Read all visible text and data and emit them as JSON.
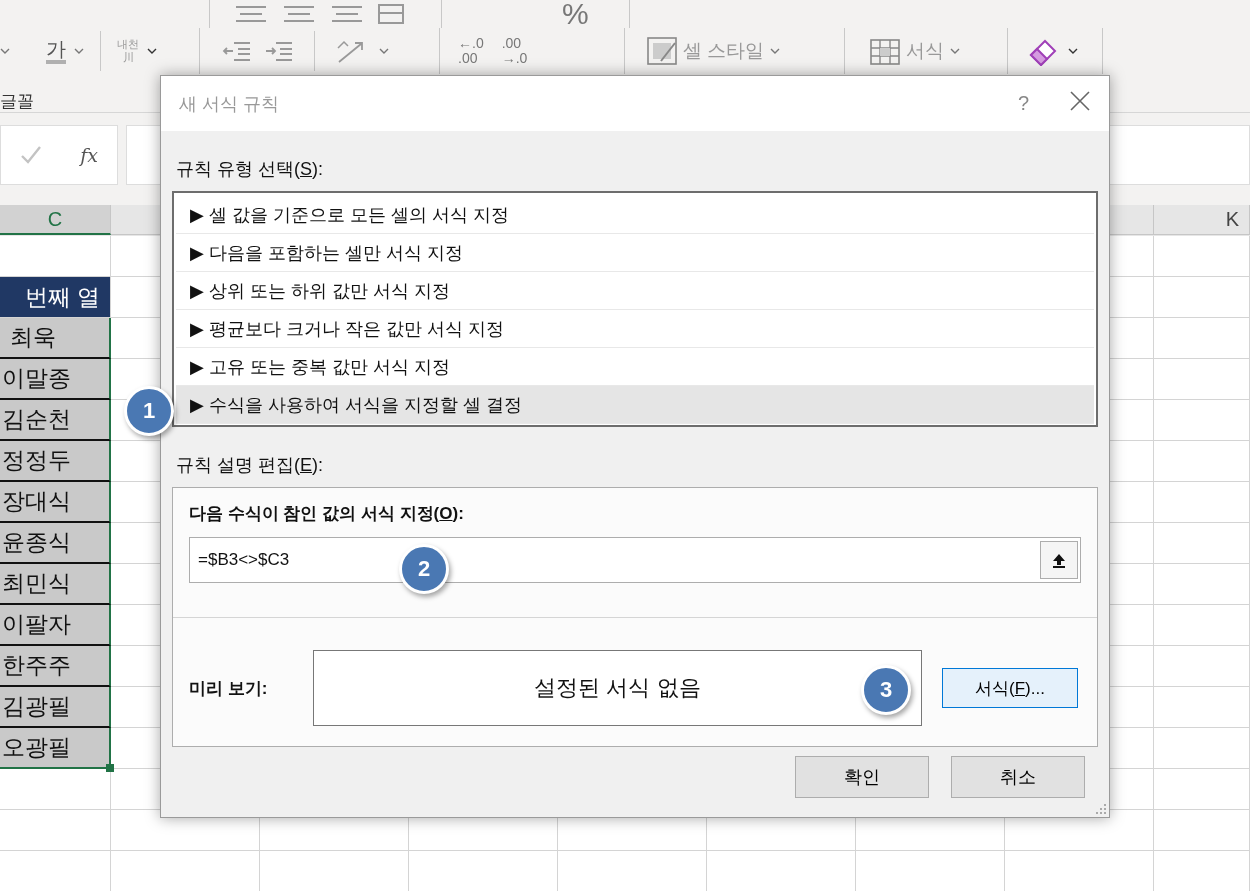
{
  "ribbon": {
    "font_color": "가",
    "phonetic": [
      "내천",
      "川"
    ],
    "percent": "%",
    "decimals": [
      {
        "top": "←.0",
        "bottom": ".00"
      },
      {
        "top": ".00",
        "bottom": "→.0"
      }
    ],
    "cell_styles": "셀 스타일",
    "format": "서식",
    "group_label": "글꼴"
  },
  "formula_bar": {
    "function_label": "fx"
  },
  "sheet": {
    "columns": [
      {
        "label": "C"
      },
      {
        "label": "K"
      }
    ],
    "column_header": "번째 열",
    "names": [
      "최욱",
      "이말종",
      "김순천",
      "정정두",
      "장대식",
      "윤종식",
      "최민식",
      "이팔자",
      "한주주",
      "김광필",
      "오광필"
    ]
  },
  "dialog": {
    "title": "새 서식 규칙",
    "help": "?",
    "rule_type_label": {
      "before": "규칙 유형 선택(",
      "key": "S",
      "after": "):"
    },
    "rule_types": [
      {
        "label": "▶ 셀 값을 기준으로 모든 셀의 서식 지정",
        "selected": false
      },
      {
        "label": "▶ 다음을 포함하는 셀만 서식 지정",
        "selected": false
      },
      {
        "label": "▶ 상위 또는 하위 값만 서식 지정",
        "selected": false
      },
      {
        "label": "▶ 평균보다 크거나 작은 값만 서식 지정",
        "selected": false
      },
      {
        "label": "▶ 고유 또는 중복 값만 서식 지정",
        "selected": false
      },
      {
        "label": "▶ 수식을 사용하여 서식을 지정할 셀 결정",
        "selected": true
      }
    ],
    "edit_label": {
      "before": "규칙 설명 편집(",
      "key": "E",
      "after": "):"
    },
    "formula_label": {
      "before": "다음 수식이 참인 값의 서식 지정(",
      "key": "O",
      "after": "):"
    },
    "formula": "=$B3<>$C3",
    "preview_label": "미리 보기:",
    "preview_text": "설정된 서식 없음",
    "format_button": {
      "before": "서식(",
      "key": "F",
      "after": ")..."
    },
    "buttons": [
      "확인",
      "취소"
    ]
  },
  "callouts": [
    "1",
    "2",
    "3"
  ]
}
